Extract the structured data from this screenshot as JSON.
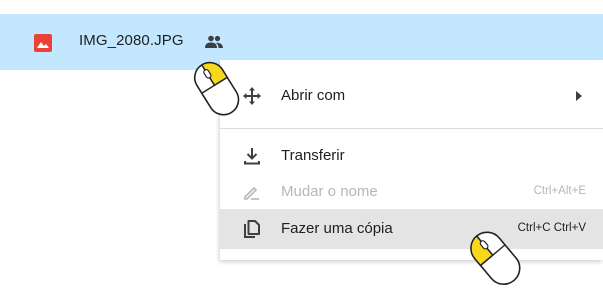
{
  "file": {
    "name": "IMG_2080.JPG",
    "type_icon": "image-file-icon",
    "shared_icon": "people-icon"
  },
  "menu": {
    "items": [
      {
        "label": "Abrir com",
        "icon": "open-with-icon",
        "shortcut": "",
        "submenu": true,
        "disabled": false
      },
      {
        "label": "Transferir",
        "icon": "download-icon",
        "shortcut": "",
        "disabled": false
      },
      {
        "label": "Mudar o nome",
        "icon": "rename-pencil-icon",
        "shortcut": "Ctrl+Alt+E",
        "disabled": true
      },
      {
        "label": "Fazer uma cópia",
        "icon": "copy-icon",
        "shortcut": "Ctrl+C Ctrl+V",
        "disabled": false,
        "hovered": true
      }
    ]
  },
  "colors": {
    "selected_row": "#c2e7ff",
    "image_icon": "#ea4335",
    "hover_bg": "#e4e4e4",
    "mouse_button_highlight": "#f9d71c"
  }
}
